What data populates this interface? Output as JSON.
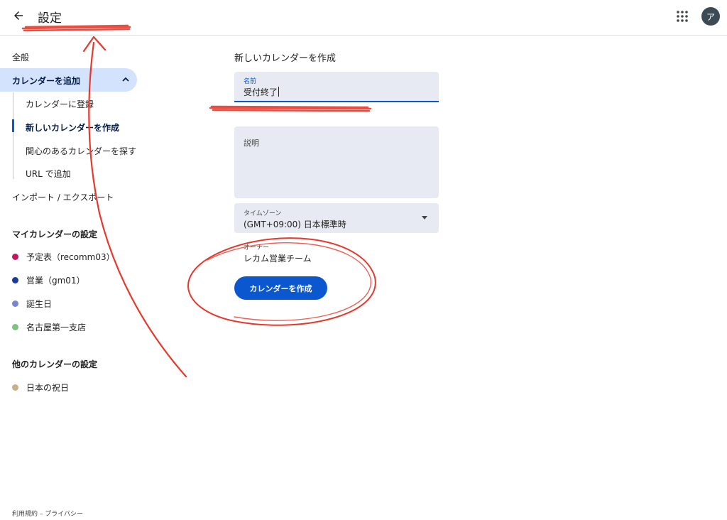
{
  "header": {
    "back_icon": "arrow-left-icon",
    "title": "設定",
    "apps_icon": "apps-grid-icon",
    "avatar_initial": "ア"
  },
  "sidebar": {
    "general": "全般",
    "add_calendar": "カレンダーを追加",
    "add_calendar_chevron": "chevron-up-icon",
    "add_calendar_items": [
      {
        "label": "カレンダーに登録",
        "active": false
      },
      {
        "label": "新しいカレンダーを作成",
        "active": true
      },
      {
        "label": "関心のあるカレンダーを探す",
        "active": false
      },
      {
        "label": "URL で追加",
        "active": false
      }
    ],
    "import_export": "インポート / エクスポート",
    "my_calendars_heading": "マイカレンダーの設定",
    "my_calendars": [
      {
        "label": "予定表（recomm03）",
        "color": "#c2185b"
      },
      {
        "label": "営業（gm01）",
        "color": "#1a3a9c"
      },
      {
        "label": "誕生日",
        "color": "#7986cb"
      },
      {
        "label": "名古屋第一支店",
        "color": "#7bc47f"
      }
    ],
    "other_calendars_heading": "他のカレンダーの設定",
    "other_calendars": [
      {
        "label": "日本の祝日",
        "color": "#c8b18a"
      }
    ]
  },
  "main": {
    "section_title": "新しいカレンダーを作成",
    "name_label": "名前",
    "name_value": "受付終了",
    "description_label": "説明",
    "timezone_label": "タイムゾーン",
    "timezone_value": "(GMT+09:00) 日本標準時",
    "owner_label": "オーナー",
    "owner_value": "レカム営業チーム",
    "create_button": "カレンダーを作成"
  },
  "footer": {
    "links": "利用規約 – プライバシー"
  },
  "colors": {
    "accent": "#0b57d0",
    "active_nav_bg": "#d3e3fd",
    "field_bg": "#e7eaf2",
    "annotation_red": "#e8382b"
  }
}
